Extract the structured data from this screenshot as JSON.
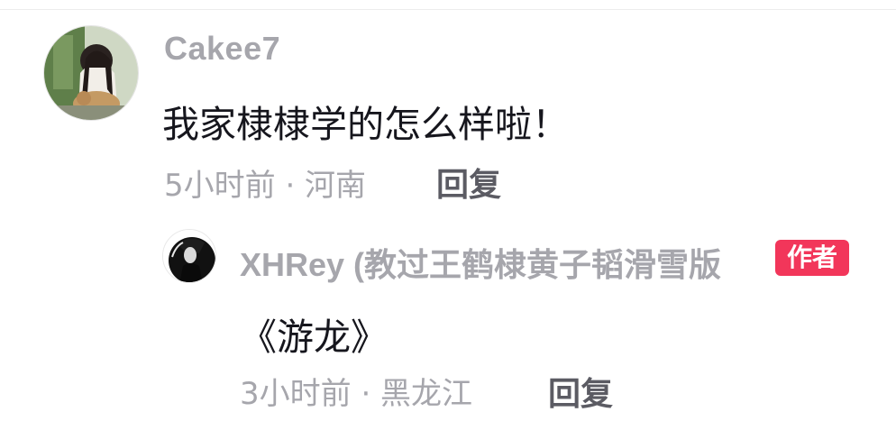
{
  "comments": [
    {
      "username": "Cakee7",
      "text": "我家棣棣学的怎么样啦！",
      "meta": "5小时前 · 河南",
      "reply_label": "回复"
    }
  ],
  "reply": {
    "username": "XHRey (教过王鹤棣黄子韬滑雪版",
    "author_badge": "作者",
    "text": "《游龙》",
    "meta": "3小时前 · 黑龙江",
    "reply_label": "回复"
  },
  "colors": {
    "username": "#a6a6ac",
    "text": "#16161d",
    "meta": "#a6a6ac",
    "reply_button": "#5b5b63",
    "author_badge_bg": "#f2365a"
  },
  "icons": {
    "main_avatar": "user-avatar-photo",
    "reply_avatar": "author-avatar-photo"
  }
}
